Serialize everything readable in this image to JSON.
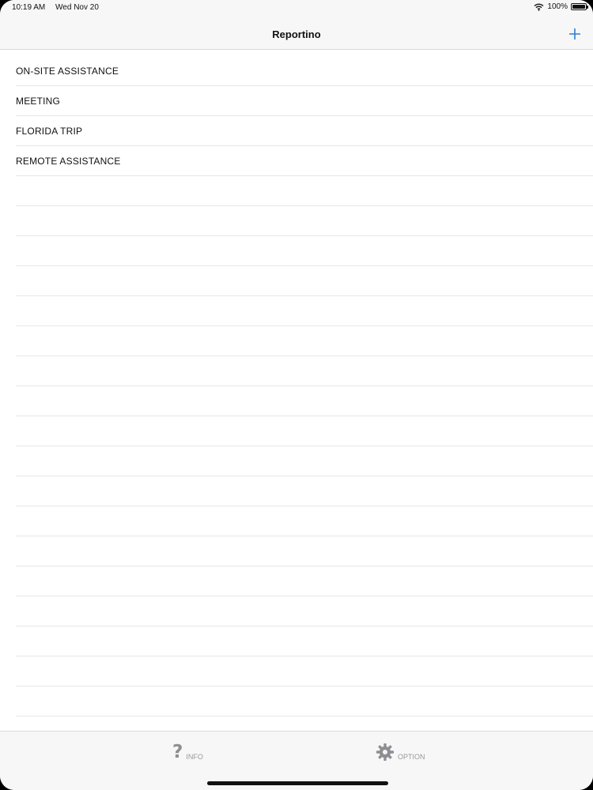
{
  "status_bar": {
    "time": "10:19 AM",
    "date": "Wed Nov 20",
    "battery": "100%"
  },
  "nav": {
    "title": "Reportino",
    "add_icon": "plus-icon",
    "accent": "#2f7fd6"
  },
  "list": {
    "items": [
      {
        "label": "ON-SITE ASSISTANCE"
      },
      {
        "label": "MEETING"
      },
      {
        "label": "FLORIDA TRIP"
      },
      {
        "label": "REMOTE ASSISTANCE"
      }
    ],
    "empty_rows": 18
  },
  "tab_bar": {
    "tabs": [
      {
        "label": "INFO",
        "icon": "question-mark-icon"
      },
      {
        "label": "OPTION",
        "icon": "gear-icon"
      }
    ]
  }
}
